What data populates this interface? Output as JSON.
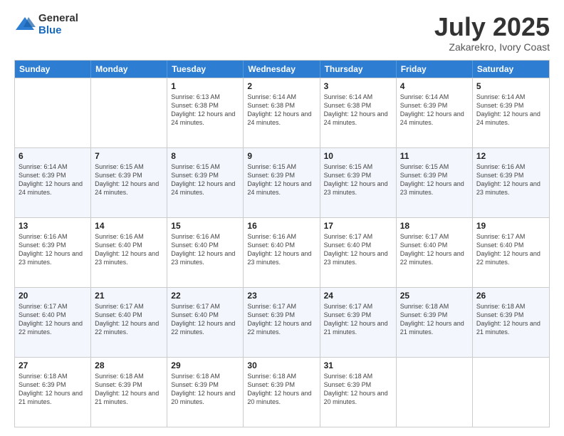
{
  "logo": {
    "general": "General",
    "blue": "Blue"
  },
  "title": "July 2025",
  "subtitle": "Zakarekro, Ivory Coast",
  "weekdays": [
    "Sunday",
    "Monday",
    "Tuesday",
    "Wednesday",
    "Thursday",
    "Friday",
    "Saturday"
  ],
  "weeks": [
    [
      {
        "day": "",
        "empty": true
      },
      {
        "day": "",
        "empty": true
      },
      {
        "day": "1",
        "sunrise": "6:13 AM",
        "sunset": "6:38 PM",
        "daylight": "12 hours and 24 minutes."
      },
      {
        "day": "2",
        "sunrise": "6:14 AM",
        "sunset": "6:38 PM",
        "daylight": "12 hours and 24 minutes."
      },
      {
        "day": "3",
        "sunrise": "6:14 AM",
        "sunset": "6:38 PM",
        "daylight": "12 hours and 24 minutes."
      },
      {
        "day": "4",
        "sunrise": "6:14 AM",
        "sunset": "6:39 PM",
        "daylight": "12 hours and 24 minutes."
      },
      {
        "day": "5",
        "sunrise": "6:14 AM",
        "sunset": "6:39 PM",
        "daylight": "12 hours and 24 minutes."
      }
    ],
    [
      {
        "day": "6",
        "sunrise": "6:14 AM",
        "sunset": "6:39 PM",
        "daylight": "12 hours and 24 minutes."
      },
      {
        "day": "7",
        "sunrise": "6:15 AM",
        "sunset": "6:39 PM",
        "daylight": "12 hours and 24 minutes."
      },
      {
        "day": "8",
        "sunrise": "6:15 AM",
        "sunset": "6:39 PM",
        "daylight": "12 hours and 24 minutes."
      },
      {
        "day": "9",
        "sunrise": "6:15 AM",
        "sunset": "6:39 PM",
        "daylight": "12 hours and 24 minutes."
      },
      {
        "day": "10",
        "sunrise": "6:15 AM",
        "sunset": "6:39 PM",
        "daylight": "12 hours and 23 minutes."
      },
      {
        "day": "11",
        "sunrise": "6:15 AM",
        "sunset": "6:39 PM",
        "daylight": "12 hours and 23 minutes."
      },
      {
        "day": "12",
        "sunrise": "6:16 AM",
        "sunset": "6:39 PM",
        "daylight": "12 hours and 23 minutes."
      }
    ],
    [
      {
        "day": "13",
        "sunrise": "6:16 AM",
        "sunset": "6:39 PM",
        "daylight": "12 hours and 23 minutes."
      },
      {
        "day": "14",
        "sunrise": "6:16 AM",
        "sunset": "6:40 PM",
        "daylight": "12 hours and 23 minutes."
      },
      {
        "day": "15",
        "sunrise": "6:16 AM",
        "sunset": "6:40 PM",
        "daylight": "12 hours and 23 minutes."
      },
      {
        "day": "16",
        "sunrise": "6:16 AM",
        "sunset": "6:40 PM",
        "daylight": "12 hours and 23 minutes."
      },
      {
        "day": "17",
        "sunrise": "6:17 AM",
        "sunset": "6:40 PM",
        "daylight": "12 hours and 23 minutes."
      },
      {
        "day": "18",
        "sunrise": "6:17 AM",
        "sunset": "6:40 PM",
        "daylight": "12 hours and 22 minutes."
      },
      {
        "day": "19",
        "sunrise": "6:17 AM",
        "sunset": "6:40 PM",
        "daylight": "12 hours and 22 minutes."
      }
    ],
    [
      {
        "day": "20",
        "sunrise": "6:17 AM",
        "sunset": "6:40 PM",
        "daylight": "12 hours and 22 minutes."
      },
      {
        "day": "21",
        "sunrise": "6:17 AM",
        "sunset": "6:40 PM",
        "daylight": "12 hours and 22 minutes."
      },
      {
        "day": "22",
        "sunrise": "6:17 AM",
        "sunset": "6:40 PM",
        "daylight": "12 hours and 22 minutes."
      },
      {
        "day": "23",
        "sunrise": "6:17 AM",
        "sunset": "6:39 PM",
        "daylight": "12 hours and 22 minutes."
      },
      {
        "day": "24",
        "sunrise": "6:17 AM",
        "sunset": "6:39 PM",
        "daylight": "12 hours and 21 minutes."
      },
      {
        "day": "25",
        "sunrise": "6:18 AM",
        "sunset": "6:39 PM",
        "daylight": "12 hours and 21 minutes."
      },
      {
        "day": "26",
        "sunrise": "6:18 AM",
        "sunset": "6:39 PM",
        "daylight": "12 hours and 21 minutes."
      }
    ],
    [
      {
        "day": "27",
        "sunrise": "6:18 AM",
        "sunset": "6:39 PM",
        "daylight": "12 hours and 21 minutes."
      },
      {
        "day": "28",
        "sunrise": "6:18 AM",
        "sunset": "6:39 PM",
        "daylight": "12 hours and 21 minutes."
      },
      {
        "day": "29",
        "sunrise": "6:18 AM",
        "sunset": "6:39 PM",
        "daylight": "12 hours and 20 minutes."
      },
      {
        "day": "30",
        "sunrise": "6:18 AM",
        "sunset": "6:39 PM",
        "daylight": "12 hours and 20 minutes."
      },
      {
        "day": "31",
        "sunrise": "6:18 AM",
        "sunset": "6:39 PM",
        "daylight": "12 hours and 20 minutes."
      },
      {
        "day": "",
        "empty": true
      },
      {
        "day": "",
        "empty": true
      }
    ]
  ]
}
